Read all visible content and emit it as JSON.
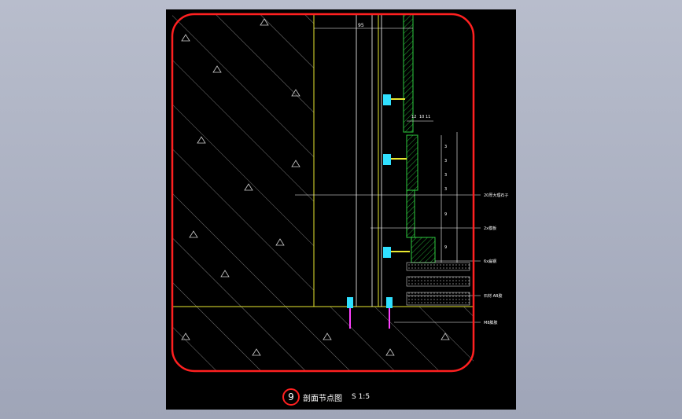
{
  "drawing": {
    "title_number": "9",
    "title_name": "剖面节点图",
    "scale": "S 1:5",
    "dim_top": "95",
    "dim_small": [
      "12",
      "10",
      "11"
    ],
    "dim_right": [
      "3",
      "3",
      "3",
      "3",
      "9",
      "9"
    ],
    "callouts": [
      "20厚大理石子",
      "2x模板",
      "6x扁钢",
      "石材 AB胶",
      "M8膨胀"
    ],
    "colors": {
      "border": "#ff2020",
      "wall_line": "#e8e830",
      "hatch": "#cfcfcf",
      "green": "#2ecc40",
      "cyan": "#30e0ff",
      "magenta": "#ff40ff",
      "white": "#ffffff"
    }
  }
}
